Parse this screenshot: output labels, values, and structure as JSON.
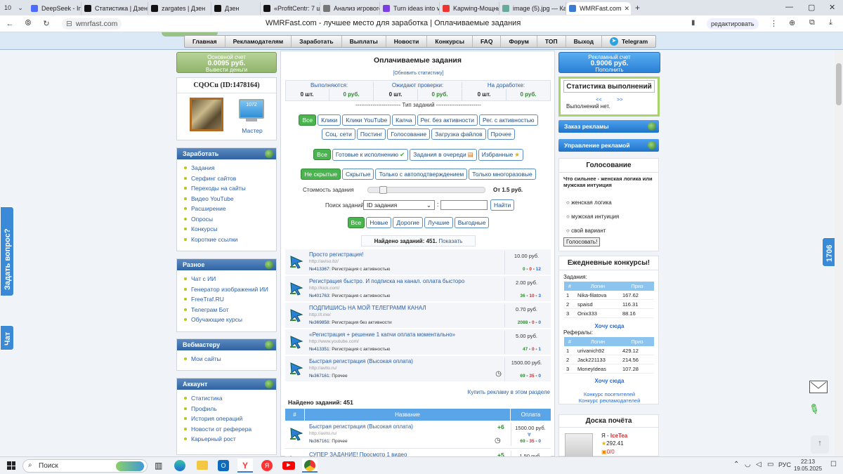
{
  "browser": {
    "tab_counter": "10",
    "tabs": [
      {
        "label": "DeepSeek - Into th",
        "color": "#4d6bfe"
      },
      {
        "label": "Статистика | Дзен",
        "color": "#111"
      },
      {
        "label": "zargates | Дзен",
        "color": "#111"
      },
      {
        "label": "Дзен",
        "color": "#111"
      },
      {
        "label": "«ProfitCentr: 7 шаг",
        "color": "#111"
      },
      {
        "label": "Анализ игрового п",
        "color": "#777"
      },
      {
        "label": "Turn ideas into vide",
        "color": "#7b3fe4"
      },
      {
        "label": "Kapwing-Мощный",
        "color": "#e33"
      },
      {
        "label": "image (5).jpg — Ка",
        "color": "#6a9"
      },
      {
        "label": "WMRFast.com",
        "color": "#3a7bd5"
      }
    ],
    "url": "wmrfast.com",
    "page_title": "WMRFast.com - лучшее место для заработка | Оплачиваемые задания",
    "edit_label": "редактировать"
  },
  "menu": [
    "Главная",
    "Рекламодателям",
    "Заработать",
    "Выплаты",
    "Новости",
    "Конкурсы",
    "FAQ",
    "Форум",
    "ТОП",
    "Выход",
    "Telegram"
  ],
  "left": {
    "main_account": {
      "label": "Основной счет",
      "amount": "0.0095 руб.",
      "action": "Вывести деньги"
    },
    "user": "CQOCu (ID:1478164)",
    "master_count": "1072",
    "master_label": "Мастер",
    "earn": {
      "title": "Заработать",
      "items": [
        "Задания",
        "Серфинг сайтов",
        "Переходы на сайты",
        "Видео YouTube",
        "Расширение",
        "Опросы",
        "Конкурсы",
        "Короткие ссылки"
      ]
    },
    "misc": {
      "title": "Разное",
      "items": [
        "Чат с ИИ",
        "Генератор изображений ИИ",
        "FreeTraf.RU",
        "Телеграм Бот",
        "Обучающие курсы"
      ]
    },
    "webmaster": {
      "title": "Вебмастеру",
      "items": [
        "Мои сайты"
      ]
    },
    "account": {
      "title": "Аккаунт",
      "items": [
        "Статистика",
        "Профиль",
        "История операций",
        "Новости от реферера",
        "Карьерный рост"
      ]
    }
  },
  "side_tabs": {
    "ask": "Задать вопрос?",
    "chat": "Чат",
    "counter": "1706"
  },
  "center": {
    "title": "Оплачиваемые задания",
    "refresh": "[Обновить статистику]",
    "stats": {
      "headers": [
        "Выполняются:",
        "Ожидают проверки:",
        "На доработке:"
      ],
      "values": [
        "0 шт.",
        "0 руб.",
        "0 шт.",
        "0 руб.",
        "0 шт.",
        "0 руб."
      ]
    },
    "type_label": "------------------------ Тип заданий ------------------------",
    "types_row1": [
      "Все",
      "Клики",
      "Клики YouTube",
      "Капча",
      "Рег. без активности",
      "Рег. с активностью"
    ],
    "types_row2": [
      "Соц. сети",
      "Постинг",
      "Голосование",
      "Загрузка файлов",
      "Прочее"
    ],
    "state_row": [
      "Все",
      "Готовые к исполнению",
      "Задания в очереди",
      "Избранные"
    ],
    "visibility_row": [
      "Не скрытые",
      "Скрытые",
      "Только с автоподтверждением",
      "Только многоразовые"
    ],
    "cost_label": "Стоимость задания",
    "cost_value": "От 1.5 руб.",
    "slider_fraction": 0.1,
    "search_label": "Поиск заданий",
    "search_select": "ID задания",
    "search_button": "Найти",
    "sort_row": [
      "Все",
      "Новые",
      "Дорогие",
      "Лучшие",
      "Выгодные"
    ],
    "found": "Найдено заданий: 451.",
    "show": "Показать",
    "tasks": [
      {
        "title": "Просто регистрация!",
        "url": "http://aviso.bz/",
        "id": "№413367:",
        "type": "Регистрация с активностью",
        "price": "10.00 руб.",
        "s": [
          "0",
          "0",
          "12"
        ]
      },
      {
        "title": "Регистрация быстро. И подписка на канал. оплата бысторо",
        "url": "http://kick.com/",
        "id": "№401763:",
        "type": "Регистрация с активностью",
        "price": "2.00 руб.",
        "s": [
          "36",
          "10",
          "3"
        ]
      },
      {
        "title": "ПОДПИШИСЬ НА МОЙ ТЕЛЕГРАММ КАНАЛ",
        "url": "http://t.me/",
        "id": "№369858:",
        "type": "Регистрация без активности",
        "price": "0.70 руб.",
        "s": [
          "2088",
          "0",
          "0"
        ]
      },
      {
        "title": "«Регистрация + решение 1 капчи оплата моментально»",
        "url": "http://www.youtube.com/",
        "id": "№413351:",
        "type": "Регистрация с активностью",
        "price": "5.00 руб.",
        "s": [
          "47",
          "0",
          "1"
        ]
      },
      {
        "title": "Быстрая регистрация (Высокая оплата)",
        "url": "http://avito.ru/",
        "id": "№367161:",
        "type": "Прочее",
        "price": "1500.00 руб.",
        "s": [
          "69",
          "35",
          "0"
        ]
      }
    ],
    "buy_link": "Купить рекламу в этом разделе",
    "found2": "Найдено заданий: 451",
    "table_headers": [
      "#",
      "Название",
      "Оплата"
    ],
    "table_rows": [
      {
        "title": "Быстрая регистрация (Высокая оплата)",
        "url": "http://avito.ru/",
        "id": "№367161:",
        "type": "Прочее",
        "bonus": "+6",
        "price": "1500.00 руб.",
        "s": [
          "69",
          "35",
          "0"
        ]
      },
      {
        "title": "СУПЕР ЗАДАНИЕ! Просмотр 1 видео",
        "bonus": "+5",
        "price": "1.50 руб."
      }
    ]
  },
  "right": {
    "ad_account": {
      "label": "Рекламный счет",
      "amount": "0.9006 руб.",
      "action": "Пополнить"
    },
    "stats_title": "Статистика выполнений",
    "stats_nav": [
      "<<",
      ">>"
    ],
    "stats_empty": "Выполнений нет.",
    "order_ads": "Заказ рекламы",
    "manage_ads": "Управление рекламой",
    "poll": {
      "title": "Голосование",
      "question": "Что сильнее - женская логика или мужская интуиция",
      "options": [
        "женская логика",
        "мужская интуиция",
        "свой вариант"
      ],
      "button": "Голосовать!"
    },
    "contests": {
      "title": "Ежедневные конкурсы!",
      "tasks_label": "Задания:",
      "headers": [
        "#",
        "Логин",
        "Приз"
      ],
      "tasks": [
        [
          "1",
          "Nika-filatova",
          "167.62"
        ],
        [
          "2",
          "spaisd",
          "116.31"
        ],
        [
          "3",
          "Onix333",
          "88.16"
        ]
      ],
      "want": "Хочу сюда",
      "refs_label": "Рефералы:",
      "refs": [
        [
          "1",
          "urivanich92",
          "429.12"
        ],
        [
          "2",
          "Jack221133",
          "214.56"
        ],
        [
          "3",
          "MoneyIdeas",
          "107.28"
        ]
      ],
      "want2": "Хочу сюда",
      "visitors": "Конкурс посетителей",
      "advertisers": "Конкурс рекламодателей"
    },
    "honor": {
      "title": "Доска почёта",
      "me_prefix": "Я -",
      "me_name": "IceTea",
      "points": "292.41",
      "score": "0/0"
    }
  },
  "taskbar": {
    "search": "Поиск",
    "lang": "РУС",
    "time": "22:13",
    "date": "19.05.2025"
  }
}
